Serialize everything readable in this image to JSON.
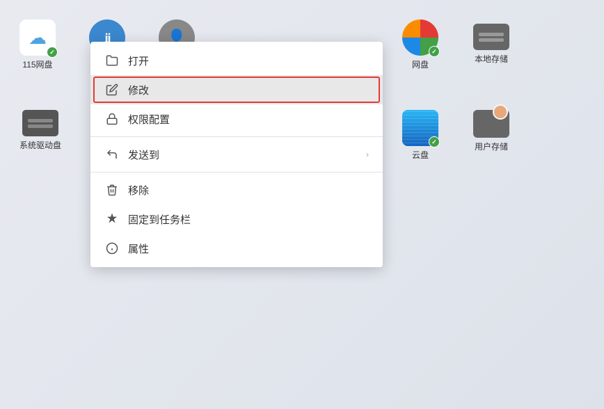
{
  "desktop": {
    "background": "#e8eaf0"
  },
  "icons": [
    {
      "id": "icon-115",
      "label": "115网盘",
      "type": "cloud115",
      "col": 1,
      "row": 1
    },
    {
      "id": "icon-yixiang",
      "label": "",
      "type": "blue-circ",
      "col": 2,
      "row": 1
    },
    {
      "id": "icon-unknown1",
      "label": "",
      "type": "gray-circ",
      "col": 3,
      "row": 1
    },
    {
      "id": "icon-netdisk",
      "label": "网盘",
      "type": "netdisk",
      "col": 7,
      "row": 1
    },
    {
      "id": "icon-localstorage",
      "label": "本地存储",
      "type": "localstorage",
      "col": 8,
      "row": 1
    },
    {
      "id": "icon-sysdrive",
      "label": "系统驱动盘",
      "type": "sysdrive",
      "col": 1,
      "row": 2
    },
    {
      "id": "icon-yundisk",
      "label": "云盘",
      "type": "yundisk",
      "col": 7,
      "row": 2
    },
    {
      "id": "icon-userstorage",
      "label": "用户存储",
      "type": "userstorage",
      "col": 8,
      "row": 2
    }
  ],
  "contextMenu": {
    "items": [
      {
        "id": "open",
        "label": "打开",
        "icon": "folder-open",
        "hasArrow": false,
        "highlighted": false
      },
      {
        "id": "modify",
        "label": "修改",
        "icon": "edit",
        "hasArrow": false,
        "highlighted": true
      },
      {
        "id": "permissions",
        "label": "权限配置",
        "icon": "permissions",
        "hasArrow": false,
        "highlighted": false
      },
      {
        "id": "divider1",
        "type": "divider"
      },
      {
        "id": "sendto",
        "label": "发送到",
        "icon": "send",
        "hasArrow": true,
        "highlighted": false
      },
      {
        "id": "divider2",
        "type": "divider"
      },
      {
        "id": "remove",
        "label": "移除",
        "icon": "trash",
        "hasArrow": false,
        "highlighted": false
      },
      {
        "id": "pin",
        "label": "固定到任务栏",
        "icon": "pin",
        "hasArrow": false,
        "highlighted": false
      },
      {
        "id": "properties",
        "label": "属性",
        "icon": "info",
        "hasArrow": false,
        "highlighted": false
      }
    ]
  }
}
